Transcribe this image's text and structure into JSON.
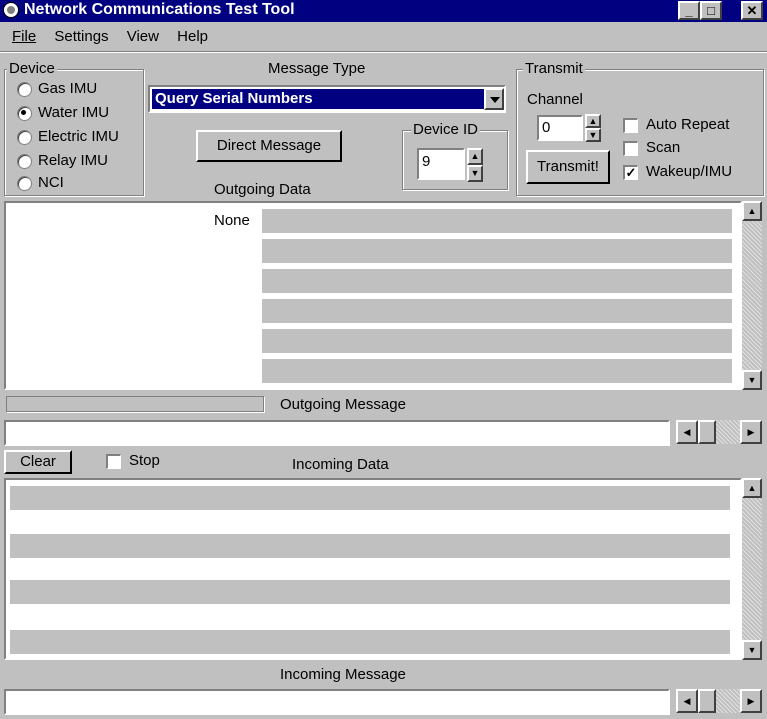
{
  "window": {
    "title": "Network Communications Test Tool",
    "minimize": "_",
    "maximize": "□",
    "close": "✕"
  },
  "menu": {
    "items": [
      "File",
      "Settings",
      "View",
      "Help"
    ]
  },
  "device": {
    "legend": "Device",
    "options": [
      "Gas IMU",
      "Water IMU",
      "Electric IMU",
      "Relay IMU",
      "NCI"
    ],
    "selected_index": 1
  },
  "message_type": {
    "label": "Message Type",
    "value": "Query Serial Numbers"
  },
  "direct_message": {
    "label": "Direct Message"
  },
  "device_id": {
    "legend": "Device ID",
    "value": "9"
  },
  "transmit": {
    "legend": "Transmit",
    "channel_label": "Channel",
    "channel_value": "0",
    "button": "Transmit!",
    "auto_repeat": "Auto Repeat",
    "scan": "Scan",
    "wakeup": "Wakeup/IMU",
    "auto_repeat_checked": false,
    "scan_checked": false,
    "wakeup_checked": true
  },
  "outgoing_data": {
    "label": "Outgoing Data",
    "first_row_label": "None"
  },
  "outgoing_message": {
    "label": "Outgoing Message",
    "value": ""
  },
  "controls": {
    "clear": "Clear",
    "stop": "Stop",
    "stop_checked": false
  },
  "incoming_data": {
    "label": "Incoming Data"
  },
  "incoming_message": {
    "label": "Incoming Message",
    "value": ""
  },
  "icons": {
    "app": "app-globe-icon",
    "dropdown": "chevron-down-icon",
    "up": "arrow-up-icon",
    "down": "arrow-down-icon",
    "left": "arrow-left-icon",
    "right": "arrow-right-icon"
  },
  "colors": {
    "titlebar": "#000080",
    "face": "#c0c0c0",
    "selection": "#000080"
  }
}
